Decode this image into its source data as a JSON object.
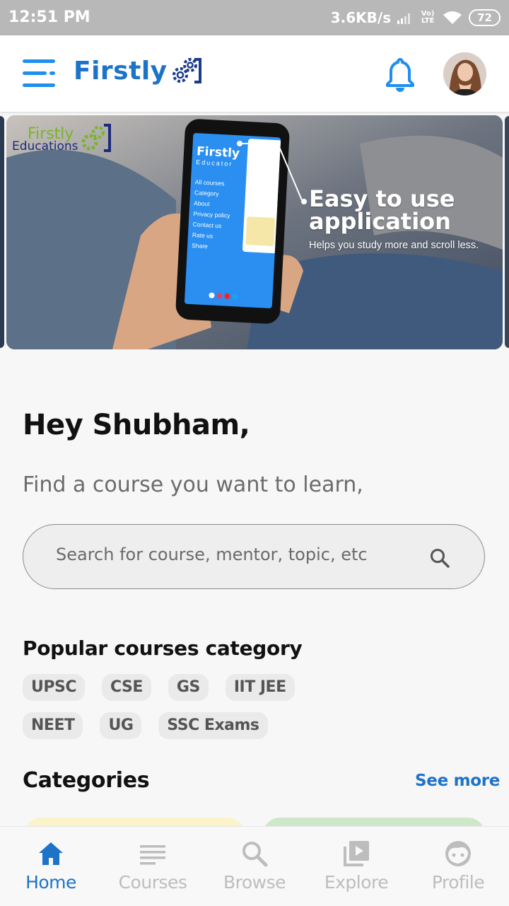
{
  "status_bar": {
    "time": "12:51 PM",
    "network_speed": "3.6KB/s",
    "carrier_badge": "Vo LTE",
    "battery": "72"
  },
  "app_bar": {
    "brand": "Firstly",
    "menu_icon": "hamburger-menu-icon",
    "notification_icon": "bell-icon",
    "avatar_icon": "profile-avatar",
    "accent_color": "#1e73c9"
  },
  "banner": {
    "logo_line1": "Firstly",
    "logo_line2": "Educations",
    "headline_line1": "Easy to use",
    "headline_line2": "application",
    "subtext": "Helps you study more and scroll less.",
    "phone_title": "Firstly",
    "phone_subtitle": "Educator",
    "phone_menu": [
      "All courses",
      "Category",
      "About",
      "Privacy policy",
      "Contact us",
      "Rate us",
      "Share"
    ]
  },
  "greeting": "Hey Shubham,",
  "subtitle": "Find a course you want to learn,",
  "search": {
    "placeholder": "Search for course, mentor, topic, etc",
    "icon": "search-icon"
  },
  "popular": {
    "title": "Popular courses category",
    "chips": [
      "UPSC",
      "CSE",
      "GS",
      "IIT JEE",
      "NEET",
      "UG",
      "SSC Exams"
    ]
  },
  "categories": {
    "title": "Categories",
    "see_more": "See more"
  },
  "bottom_nav": [
    {
      "label": "Home",
      "icon": "home-icon",
      "active": true
    },
    {
      "label": "Courses",
      "icon": "courses-icon",
      "active": false
    },
    {
      "label": "Browse",
      "icon": "search-icon",
      "active": false
    },
    {
      "label": "Explore",
      "icon": "play-library-icon",
      "active": false
    },
    {
      "label": "Profile",
      "icon": "face-icon",
      "active": false
    }
  ]
}
